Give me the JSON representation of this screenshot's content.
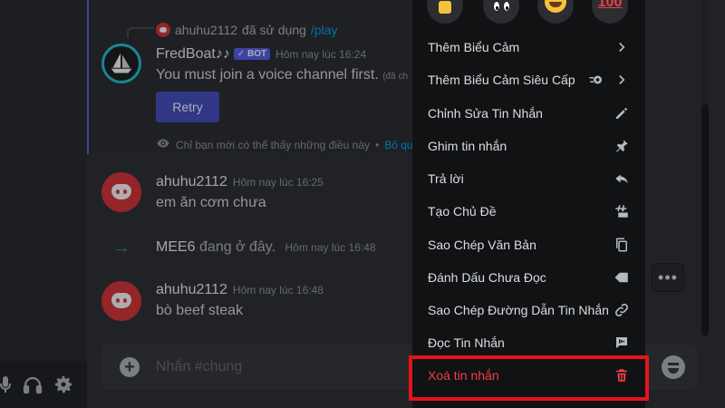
{
  "reply_context": {
    "user": "ahuhu2112",
    "verb": "đã sử dụng",
    "command": "/play"
  },
  "messages": [
    {
      "author": "FredBoat♪♪",
      "bot_tag": "✓ BOT",
      "timestamp": "Hôm nay lúc 16:24",
      "text": "You must join a voice channel first.",
      "text_tail": "(đã ch",
      "button": "Retry",
      "ephemeral_note": "Chỉ bạn mới có thể thấy những điều này",
      "ephemeral_link": "Bỏ qua"
    },
    {
      "author": "ahuhu2112",
      "timestamp": "Hôm nay lúc 16:25",
      "text": "em ăn cơm chưa"
    },
    {
      "author": "MEE6",
      "join_text": "đang ở đây.",
      "timestamp": "Hôm nay lúc 16:48"
    },
    {
      "author": "ahuhu2112",
      "timestamp": "Hôm nay lúc 16:48",
      "text": "bò beef steak"
    }
  ],
  "toolbar": {
    "more_label": "•••"
  },
  "chat_input": {
    "placeholder": "Nhắn #chung"
  },
  "context_menu": {
    "reactions": [
      "thumbs-up",
      "eyes",
      "laughing",
      "hundred"
    ],
    "hundred_label": "100",
    "items": [
      {
        "label": "Thêm Biểu Cảm",
        "icon": "chevron-right-icon"
      },
      {
        "label": "Thêm Biểu Cảm Siêu Cấp",
        "icon": "chevron-right-icon"
      },
      {
        "label": "Chỉnh Sửa Tin Nhắn",
        "icon": "pencil-icon"
      },
      {
        "label": "Ghim tin nhắn",
        "icon": "pin-icon"
      },
      {
        "label": "Trả lời",
        "icon": "reply-icon"
      },
      {
        "label": "Tạo Chủ Đề",
        "icon": "thread-icon"
      },
      {
        "label": "Sao Chép Văn Bản",
        "icon": "copy-icon"
      },
      {
        "label": "Đánh Dấu Chưa Đọc",
        "icon": "tag-icon"
      },
      {
        "label": "Sao Chép Đường Dẫn Tin Nhắn",
        "icon": "link-icon"
      },
      {
        "label": "Đọc Tin Nhắn",
        "icon": "speech-icon"
      },
      {
        "label": "Xoá tin nhắn",
        "icon": "trash-icon",
        "danger": true
      }
    ]
  },
  "colors": {
    "accent": "#5865f2",
    "danger": "#f23f42",
    "highlight_box": "#e3141c"
  }
}
